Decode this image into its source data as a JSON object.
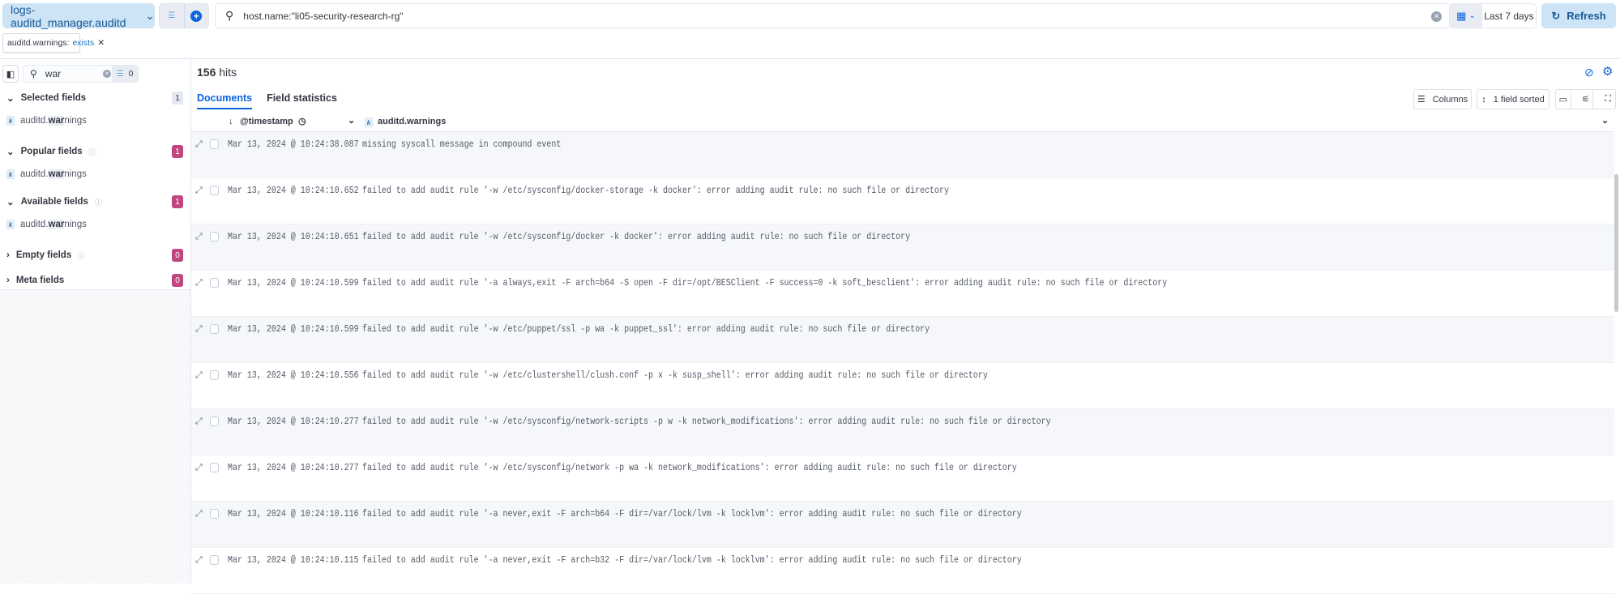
{
  "topbar": {
    "data_view": "logs-auditd_manager.auditd",
    "query": "host.name:\"li05-security-research-rg\"",
    "date_range": "Last 7 days",
    "refresh": "Refresh"
  },
  "filters": [
    {
      "field": "auditd.warnings:",
      "value": "exists"
    }
  ],
  "sidebar": {
    "search_value": "war",
    "filter_count": "0",
    "sections": [
      {
        "label": "Selected fields",
        "count": "1",
        "expanded": true,
        "fields": [
          "auditd."
        ]
      },
      {
        "label": "Popular fields",
        "count": "1",
        "expanded": true,
        "fields": [
          "auditd."
        ]
      },
      {
        "label": "Available fields",
        "count": "1",
        "expanded": true,
        "fields": [
          "auditd."
        ]
      },
      {
        "label": "Empty fields",
        "count": "0",
        "expanded": false
      },
      {
        "label": "Meta fields",
        "count": "0",
        "expanded": false
      }
    ],
    "field_match": "war",
    "field_rest": "nings",
    "field_type": "k"
  },
  "main": {
    "hits_count": "156",
    "hits_label": "hits",
    "tabs": [
      "Documents",
      "Field statistics"
    ],
    "toolbar": {
      "columns": "Columns",
      "sorted": "1 field sorted"
    },
    "columns": [
      "@timestamp",
      "auditd.warnings"
    ],
    "rows": [
      {
        "ts": "Mar 13, 2024 @ 10:24:38.087",
        "msg": "missing syscall message in compound event"
      },
      {
        "ts": "Mar 13, 2024 @ 10:24:10.652",
        "msg": "failed to add audit rule '-w /etc/sysconfig/docker-storage -k docker': error adding audit rule: no such file or directory"
      },
      {
        "ts": "Mar 13, 2024 @ 10:24:10.651",
        "msg": "failed to add audit rule '-w /etc/sysconfig/docker -k docker': error adding audit rule: no such file or directory"
      },
      {
        "ts": "Mar 13, 2024 @ 10:24:10.599",
        "msg": "failed to add audit rule '-a always,exit -F arch=b64 -S open -F dir=/opt/BESClient -F success=0 -k soft_besclient': error adding audit rule: no such file or directory"
      },
      {
        "ts": "Mar 13, 2024 @ 10:24:10.599",
        "msg": "failed to add audit rule '-w /etc/puppet/ssl -p wa -k puppet_ssl': error adding audit rule: no such file or directory"
      },
      {
        "ts": "Mar 13, 2024 @ 10:24:10.556",
        "msg": "failed to add audit rule '-w /etc/clustershell/clush.conf -p x -k susp_shell': error adding audit rule: no such file or directory"
      },
      {
        "ts": "Mar 13, 2024 @ 10:24:10.277",
        "msg": "failed to add audit rule '-w /etc/sysconfig/network-scripts -p w -k network_modifications': error adding audit rule: no such file or directory"
      },
      {
        "ts": "Mar 13, 2024 @ 10:24:10.277",
        "msg": "failed to add audit rule '-w /etc/sysconfig/network -p wa -k network_modifications': error adding audit rule: no such file or directory"
      },
      {
        "ts": "Mar 13, 2024 @ 10:24:10.116",
        "msg": "failed to add audit rule '-a never,exit -F arch=b64 -F dir=/var/lock/lvm -k locklvm': error adding audit rule: no such file or directory"
      },
      {
        "ts": "Mar 13, 2024 @ 10:24:10.115",
        "msg": "failed to add audit rule '-a never,exit -F arch=b32 -F dir=/var/lock/lvm -k locklvm': error adding audit rule: no such file or directory"
      }
    ]
  },
  "colors": {
    "accent": "#0b64dd",
    "button_bg": "#cce4f5",
    "badge": "#c1457e"
  }
}
